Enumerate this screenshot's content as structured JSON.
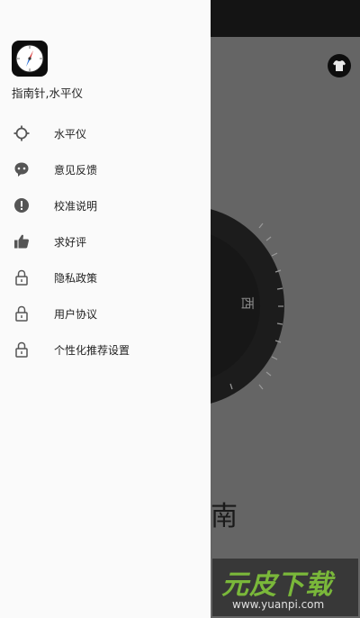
{
  "drawer": {
    "app_name": "指南针,水平仪",
    "items": [
      {
        "label": "水平仪",
        "icon": "crosshair-icon"
      },
      {
        "label": "意见反馈",
        "icon": "feedback-chat-icon"
      },
      {
        "label": "校准说明",
        "icon": "info-alert-icon"
      },
      {
        "label": "求好评",
        "icon": "thumbs-up-icon"
      },
      {
        "label": "隐私政策",
        "icon": "lock-icon"
      },
      {
        "label": "用户协议",
        "icon": "lock-icon"
      },
      {
        "label": "个性化推荐设置",
        "icon": "lock-icon"
      }
    ]
  },
  "background": {
    "dial_label": "西",
    "big_label": "南"
  },
  "watermark": {
    "brand": "元皮下载",
    "url": "www.yuanpi.com"
  },
  "colors": {
    "drawer_bg": "#fafafa",
    "scrim": "#656565",
    "watermark_green": "#7ab83a"
  }
}
